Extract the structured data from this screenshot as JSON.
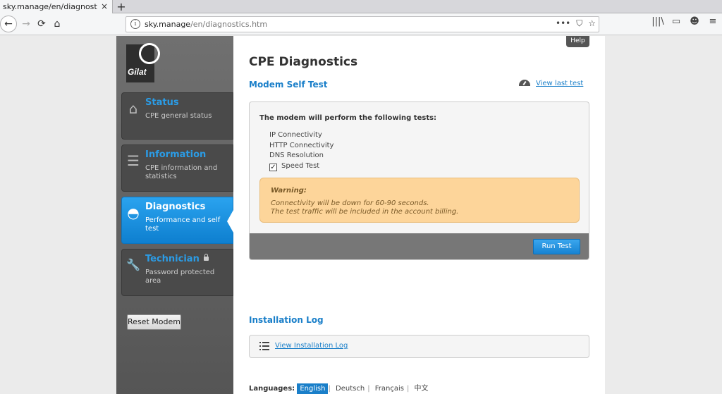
{
  "browser": {
    "tab_title": "sky.manage/en/diagnostics.h",
    "tab_close": "×",
    "new_tab": "+",
    "back": "←",
    "forward": "→",
    "reload": "⟳",
    "home": "⌂",
    "url_host": "sky.manage",
    "url_path": "/en/diagnostics.htm",
    "url_info": "i",
    "url_actions": [
      "•••",
      "⛉",
      "☆"
    ],
    "toolbar_icons": [
      "|||\\",
      "▭",
      "☻",
      "≡"
    ]
  },
  "sidebar": {
    "logo_text": "Gilat",
    "items": [
      {
        "title": "Status",
        "desc": "CPE general status",
        "icon": "home-icon",
        "glyph": "⌂"
      },
      {
        "title": "Information",
        "desc": "CPE information and statistics",
        "icon": "server-icon",
        "glyph": "☰"
      },
      {
        "title": "Diagnostics",
        "desc": "Performance and self test",
        "icon": "gauge-icon",
        "glyph": "◓"
      },
      {
        "title": "Technician",
        "desc": "Password protected area",
        "icon": "wrench-icon",
        "glyph": "🔧"
      }
    ],
    "reset_label": "Reset Modem"
  },
  "main": {
    "help_label": "Help",
    "page_title": "CPE Diagnostics",
    "self_test": {
      "title": "Modem Self Test",
      "view_last_label": "View last test",
      "intro": "The modem will perform the following tests:",
      "tests": [
        "IP Connectivity",
        "HTTP Connectivity",
        "DNS Resolution"
      ],
      "speed_test_label": "Speed Test",
      "speed_test_checked": true,
      "checkmark": "✓",
      "warning_title": "Warning:",
      "warning_lines": [
        "Connectivity will be down for 60-90 seconds.",
        "The test traffic will be included in the account billing."
      ],
      "run_label": "Run Test"
    },
    "install_log": {
      "title": "Installation Log",
      "link_label": "View Installation Log"
    },
    "languages": {
      "label": "Languages:",
      "options": [
        "English",
        "Deutsch",
        "Français",
        "中文"
      ],
      "selected": "English",
      "separator": "|"
    }
  },
  "colors": {
    "accent": "#1a7fc9",
    "active_menu": "#1e90e0",
    "warning_bg": "#fdd59a"
  }
}
